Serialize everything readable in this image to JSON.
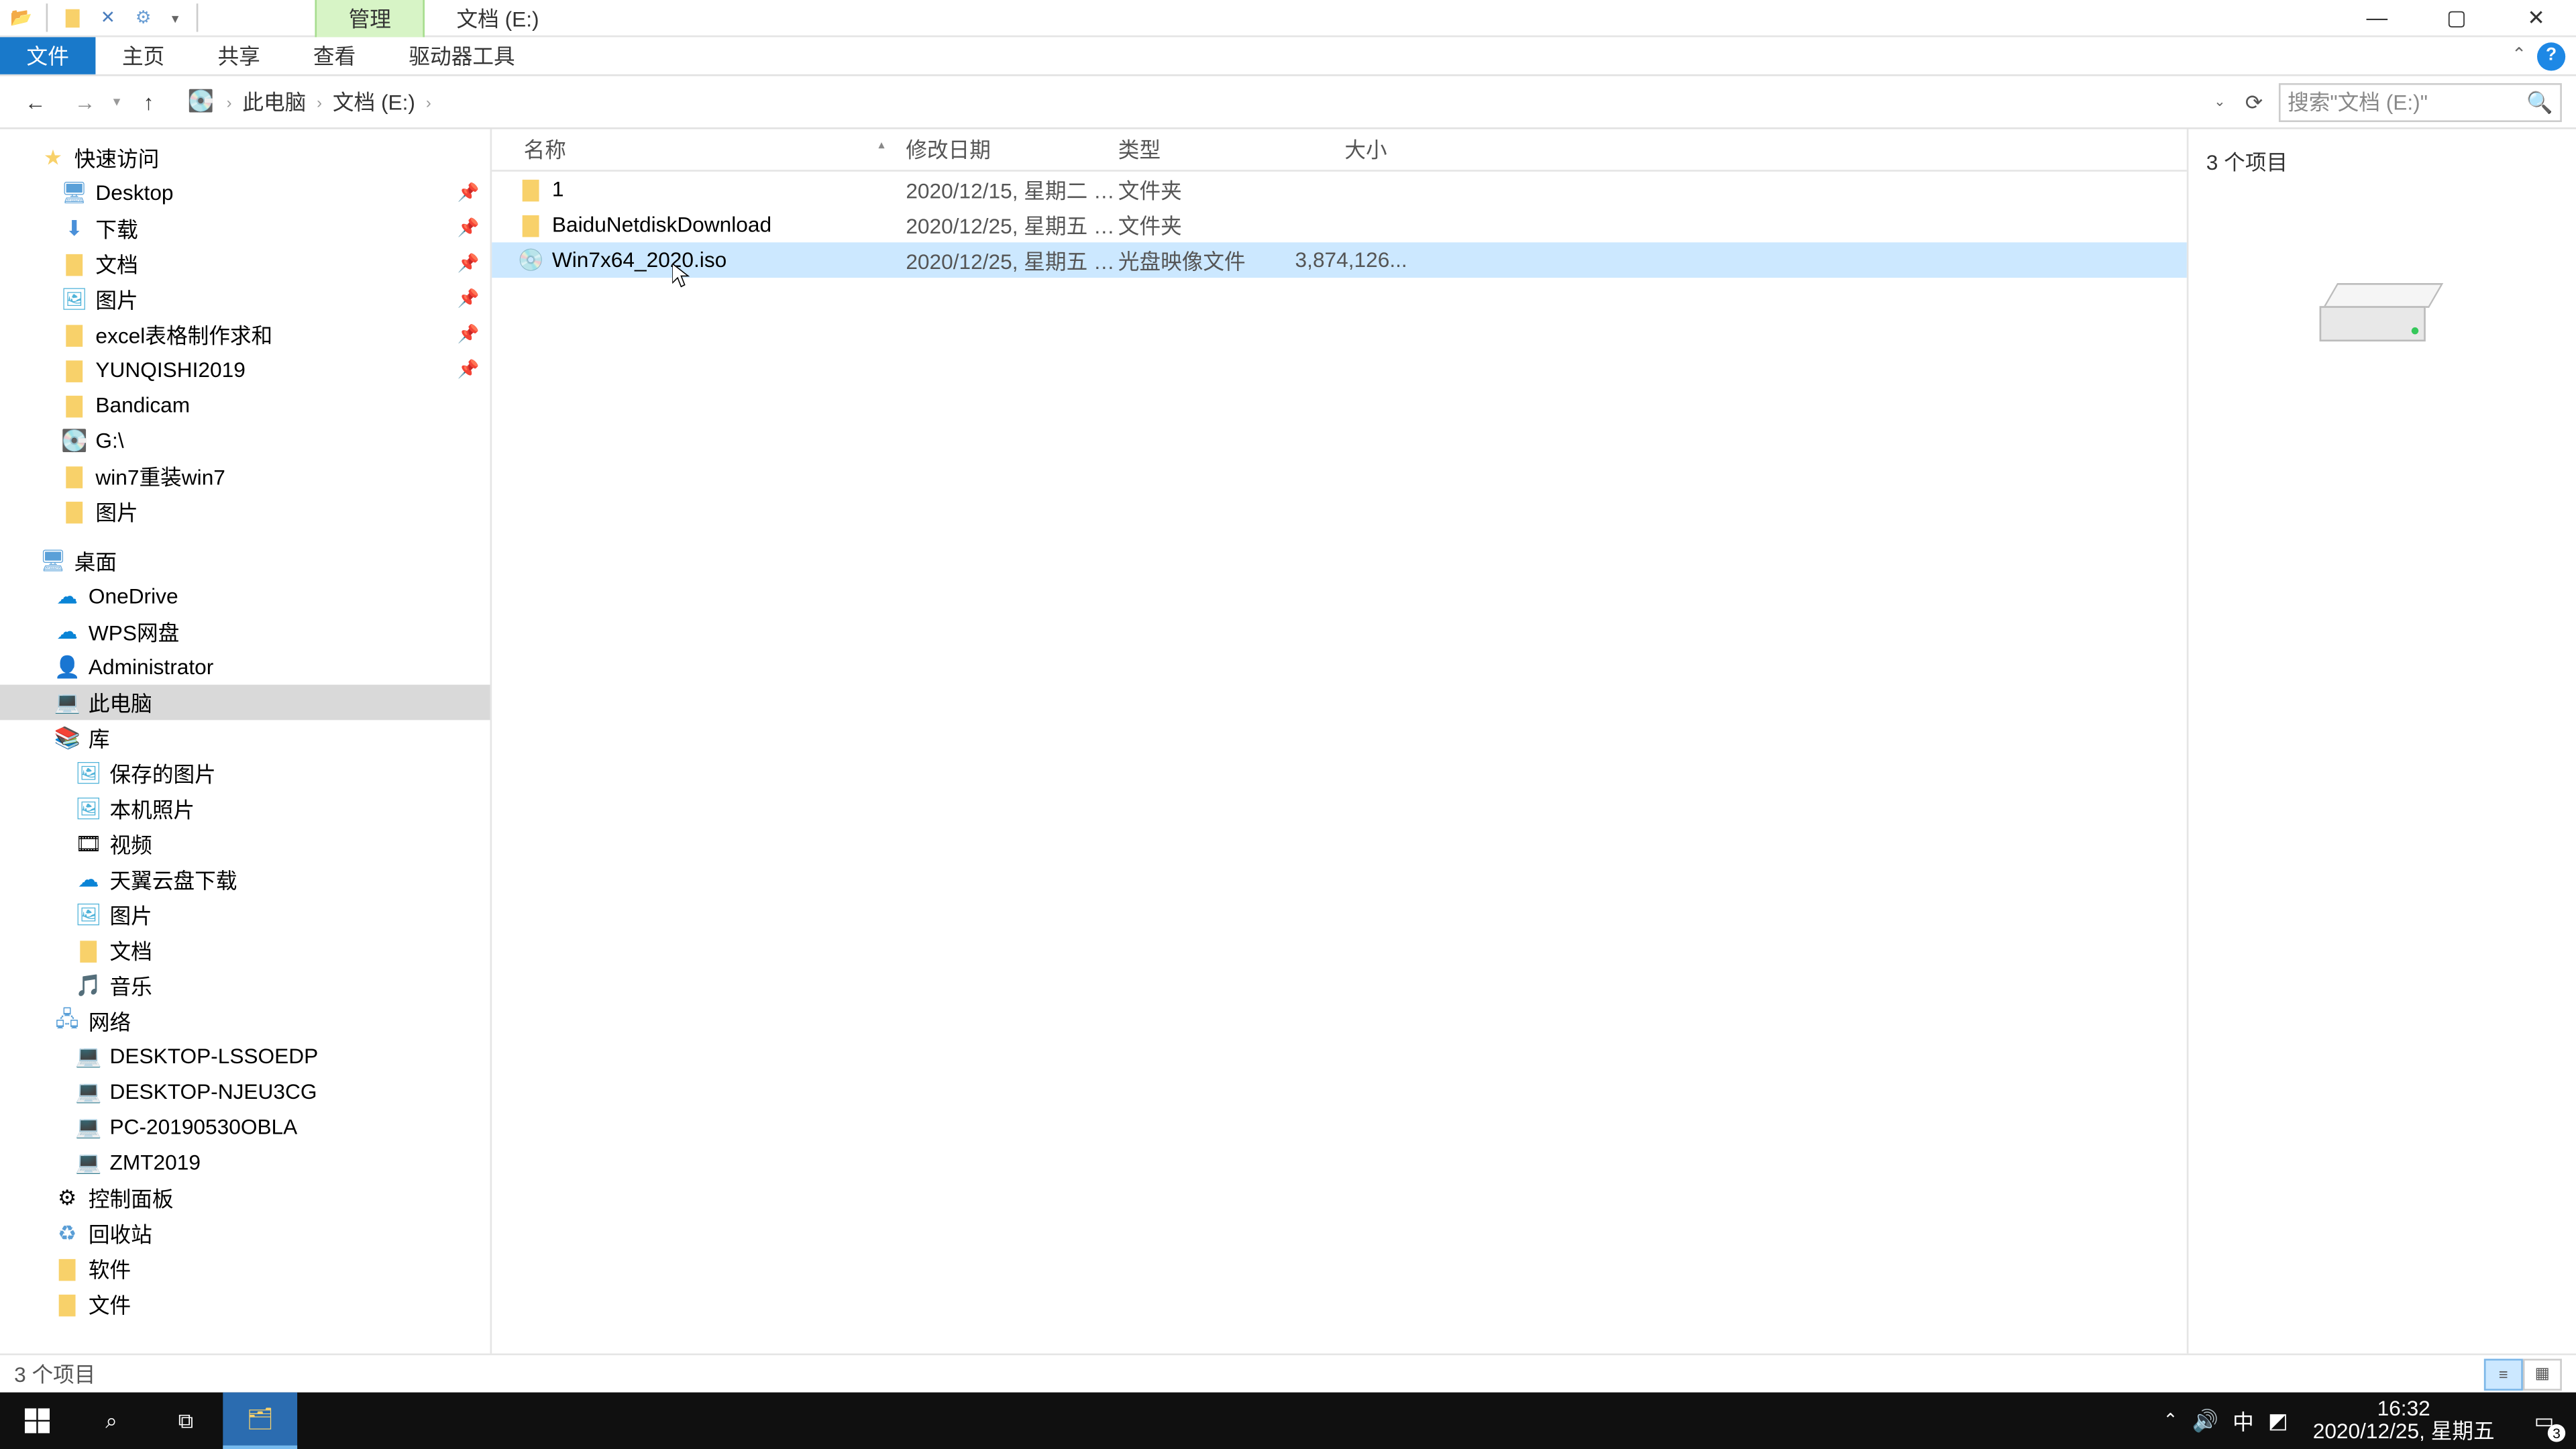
{
  "titlebar": {
    "context_tab": "管理",
    "window_title": "文档 (E:)"
  },
  "ribbon": {
    "file": "文件",
    "tabs": [
      "主页",
      "共享",
      "查看",
      "驱动器工具"
    ]
  },
  "breadcrumb": {
    "items": [
      "此电脑",
      "文档 (E:)"
    ]
  },
  "search": {
    "placeholder": "搜索\"文档 (E:)\""
  },
  "tree": {
    "quick_access": "快速访问",
    "quick_items": [
      {
        "label": "Desktop",
        "icon": "desktop",
        "pinned": true
      },
      {
        "label": "下载",
        "icon": "downarrow",
        "pinned": true
      },
      {
        "label": "文档",
        "icon": "folder",
        "pinned": true
      },
      {
        "label": "图片",
        "icon": "pic",
        "pinned": true
      },
      {
        "label": "excel表格制作求和",
        "icon": "folder",
        "pinned": true
      },
      {
        "label": "YUNQISHI2019",
        "icon": "folder",
        "pinned": true
      },
      {
        "label": "Bandicam",
        "icon": "folder",
        "pinned": false
      },
      {
        "label": "G:\\",
        "icon": "drive",
        "pinned": false
      },
      {
        "label": "win7重装win7",
        "icon": "folder",
        "pinned": false
      },
      {
        "label": "图片",
        "icon": "folder",
        "pinned": false
      }
    ],
    "desktop": "桌面",
    "desktop_items": [
      {
        "label": "OneDrive",
        "icon": "cloud"
      },
      {
        "label": "WPS网盘",
        "icon": "cloud"
      },
      {
        "label": "Administrator",
        "icon": "user"
      },
      {
        "label": "此电脑",
        "icon": "pc",
        "selected": true
      },
      {
        "label": "库",
        "icon": "lib"
      }
    ],
    "lib_items": [
      {
        "label": "保存的图片",
        "icon": "pic"
      },
      {
        "label": "本机照片",
        "icon": "pic"
      },
      {
        "label": "视频",
        "icon": "video"
      },
      {
        "label": "天翼云盘下载",
        "icon": "cloud"
      },
      {
        "label": "图片",
        "icon": "pic"
      },
      {
        "label": "文档",
        "icon": "folder"
      },
      {
        "label": "音乐",
        "icon": "music"
      }
    ],
    "network": "网络",
    "network_items": [
      {
        "label": "DESKTOP-LSSOEDP",
        "icon": "pc"
      },
      {
        "label": "DESKTOP-NJEU3CG",
        "icon": "pc"
      },
      {
        "label": "PC-20190530OBLA",
        "icon": "pc"
      },
      {
        "label": "ZMT2019",
        "icon": "pc"
      }
    ],
    "extras": [
      {
        "label": "控制面板",
        "icon": "panel"
      },
      {
        "label": "回收站",
        "icon": "recycle"
      },
      {
        "label": "软件",
        "icon": "folder"
      },
      {
        "label": "文件",
        "icon": "folder"
      }
    ]
  },
  "columns": {
    "name": "名称",
    "date": "修改日期",
    "type": "类型",
    "size": "大小"
  },
  "files": [
    {
      "name": "1",
      "date": "2020/12/15, 星期二 1...",
      "type": "文件夹",
      "size": "",
      "icon": "folder",
      "selected": false
    },
    {
      "name": "BaiduNetdiskDownload",
      "date": "2020/12/25, 星期五 1...",
      "type": "文件夹",
      "size": "",
      "icon": "folder",
      "selected": false
    },
    {
      "name": "Win7x64_2020.iso",
      "date": "2020/12/25, 星期五 1...",
      "type": "光盘映像文件",
      "size": "3,874,126...",
      "icon": "disc",
      "selected": true
    }
  ],
  "preview": {
    "count_label": "3 个项目"
  },
  "statusbar": {
    "text": "3 个项目"
  },
  "taskbar": {
    "time": "16:32",
    "date": "2020/12/25, 星期五",
    "ime": "中",
    "notif_count": "3"
  }
}
